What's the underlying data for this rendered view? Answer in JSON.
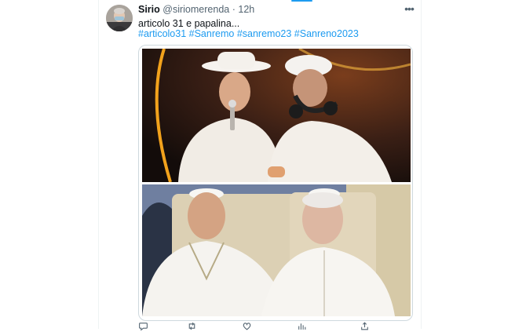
{
  "tweet": {
    "author_name": "Sirio",
    "handle": "@siriomerenda",
    "separator": "·",
    "time": "12h",
    "text": "articolo 31 e papalina...",
    "hashtags": [
      "#articolo31",
      "#Sanremo",
      "#sanremo23",
      "#Sanreno2023"
    ]
  },
  "icons": {
    "more": "more-horizontal-icon",
    "reply": "reply-icon",
    "retweet": "retweet-icon",
    "like": "like-icon",
    "views": "views-icon",
    "share": "share-icon"
  },
  "colors": {
    "link": "#1d9bf0",
    "text": "#0f1419",
    "muted": "#536471",
    "border": "#cfd9de"
  }
}
